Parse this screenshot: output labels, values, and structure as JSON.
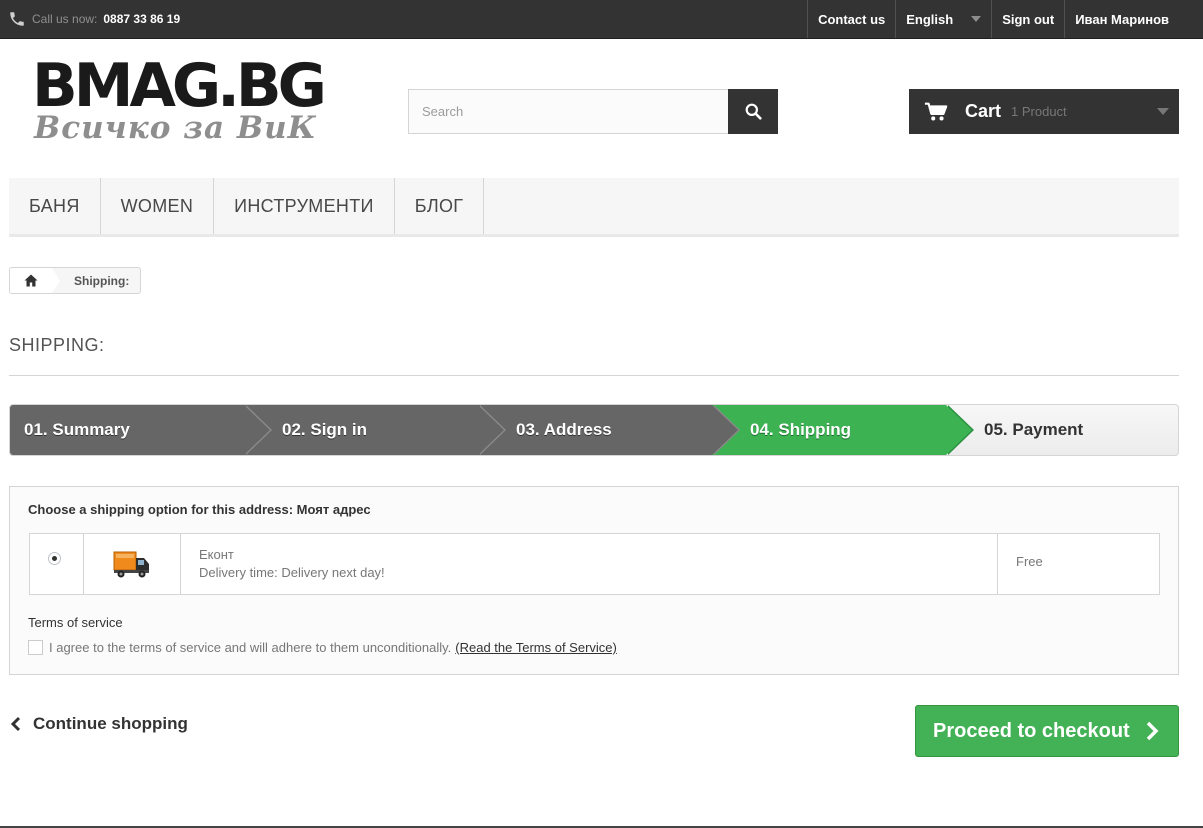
{
  "topbar": {
    "call_label": "Call us now:",
    "phone": "0887 33 86 19",
    "nav": {
      "contact": "Contact us",
      "language": "English",
      "signout": "Sign out",
      "user": "Иван Маринов"
    }
  },
  "header": {
    "logo_main": "BMAG.BG",
    "logo_sub": "Всичко за ВиК",
    "search_placeholder": "Search",
    "cart_label": "Cart",
    "cart_count": "1 Product"
  },
  "menu": [
    "Баня",
    "Women",
    "Инструменти",
    "Блог"
  ],
  "breadcrumb": {
    "current": "Shipping:"
  },
  "page_title": "Shipping:",
  "steps": [
    {
      "label": "01. Summary",
      "state": "done"
    },
    {
      "label": "02. Sign in",
      "state": "done"
    },
    {
      "label": "03. Address",
      "state": "done"
    },
    {
      "label": "04. Shipping",
      "state": "current"
    },
    {
      "label": "05. Payment",
      "state": "todo"
    }
  ],
  "shipping": {
    "title": "Choose a shipping option for this address: Моят адрес",
    "carrier": {
      "name": "Еконт",
      "delivery": "Delivery time: Delivery next day!",
      "price": "Free",
      "selected": true
    },
    "terms_title": "Terms of service",
    "terms_text": "I agree to the terms of service and will adhere to them unconditionally.",
    "terms_link": "(Read the Terms of Service)"
  },
  "actions": {
    "continue": "Continue shopping",
    "proceed": "Proceed to checkout"
  },
  "colors": {
    "dark": "#333333",
    "accent_green": "#43b155",
    "step_done": "#666666",
    "step_current": "#3cb252"
  }
}
